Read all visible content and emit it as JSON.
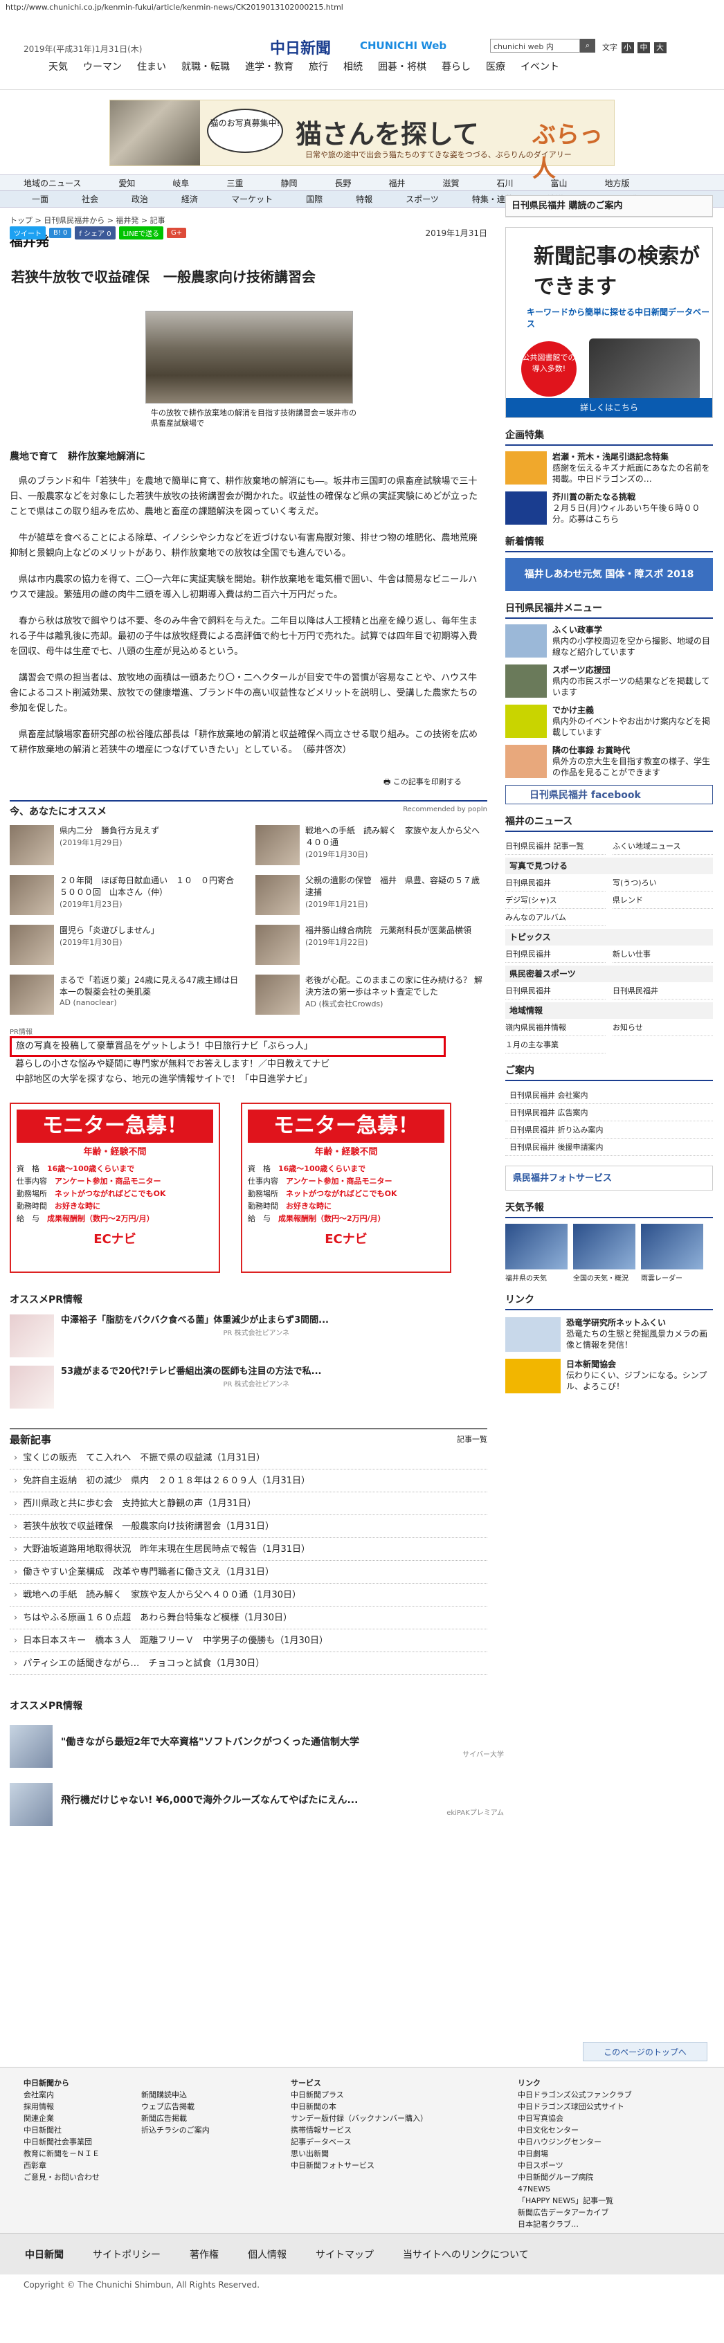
{
  "url": "http://www.chunichi.co.jp/kenmin-fukui/article/kenmin-news/CK2019013102000215.html",
  "header": {
    "date": "2019年(平成31年)1月31日(木)",
    "logo": "中日新聞",
    "logo_sub": "CHUNICHI Web",
    "search_placeholder": "chunichi web 内",
    "search_btn": "検索",
    "font_label": "文字",
    "font_small": "小",
    "font_mid": "中",
    "font_large": "大"
  },
  "gnav": [
    "天気",
    "ウーマン",
    "住まい",
    "就職・転職",
    "進学・教育",
    "旅行",
    "相続",
    "囲碁・将棋",
    "暮らし",
    "医療",
    "イベント"
  ],
  "banner": {
    "bubble": "猫のお写真募集中!",
    "title": "猫さんを探して",
    "sub": "日常や旅の途中で出会う猫たちのすてきな姿をつづる、ぶらりんのダイアリー",
    "brand": "ぶらっ人"
  },
  "cnav1": [
    "地域のニュース",
    "愛知",
    "岐阜",
    "三重",
    "静岡",
    "長野",
    "福井",
    "滋賀",
    "石川",
    "富山",
    "地方版"
  ],
  "cnav2": [
    "一面",
    "社会",
    "政治",
    "経済",
    "マーケット",
    "国際",
    "特報",
    "スポーツ",
    "特集・連載",
    "社説・コラム",
    "動画"
  ],
  "breadcrumb": "トップ > 日刊県民福井から > 福井発 > 記事",
  "section": "福井発",
  "share": [
    "ツイート",
    "B! 0",
    "f シェア 0",
    "LINEで送る",
    "G+"
  ],
  "article": {
    "date": "2019年1月31日",
    "headline": "若狭牛放牧で収益確保　一般農家向け技術講習会",
    "caption": "牛の放牧で耕作放棄地の解消を目指す技術講習会＝坂井市の県畜産試験場で",
    "subhead": "農地で育て　耕作放棄地解消に",
    "paragraphs": [
      "県のブランド和牛「若狭牛」を農地で簡単に育て、耕作放棄地の解消にも―。坂井市三国町の県畜産試験場で三十日、一般農家などを対象にした若狭牛放牧の技術講習会が開かれた。収益性の確保など県の実証実験にめどが立ったことで県はこの取り組みを広め、農地と畜産の課題解決を図っていく考えだ。",
      "牛が雑草を食べることによる除草、イノシシやシカなどを近づけない有害鳥獣対策、排せつ物の堆肥化、農地荒廃抑制と景観向上などのメリットがあり、耕作放棄地での放牧は全国でも進んでいる。",
      "県は市内農家の協力を得て、二〇一六年に実証実験を開始。耕作放棄地を電気柵で囲い、牛舎は簡易なビニールハウスで建設。繁殖用の雌の肉牛二頭を導入し初期導入費は約二百六十万円だった。",
      "春から秋は放牧で餌やりは不要、冬のみ牛舎で飼料を与えた。二年目以降は人工授精と出産を繰り返し、毎年生まれる子牛は離乳後に売却。最初の子牛は放牧経費による高評価で約七十万円で売れた。試算では四年目で初期導入費を回収、母牛は生産で七、八頭の生産が見込めるという。",
      "講習会で県の担当者は、放牧地の面積は一頭あたり〇・二ヘクタールが目安で牛の習慣が容易なことや、ハウス牛舎によるコスト削減効果、放牧での健康増進、ブランド牛の高い収益性などメリットを説明し、受講した農家たちの参加を促した。",
      "県畜産試験場家畜研究部の松谷隆広部長は「耕作放棄地の解消と収益確保へ両立させる取り組み。この技術を広めて耕作放棄地の解消と若狭牛の増産につなげていきたい」としている。　（藤井啓次）"
    ],
    "print": "この記事を印刷する"
  },
  "recommend": {
    "title": "今、あなたにオススメ",
    "by": "Recommended by popIn",
    "items": [
      {
        "t": "県内二分　勝負行方見えず",
        "s": "(2019年1月29日)"
      },
      {
        "t": "戦地への手紙　読み解く　家族や友人から父へ４００通",
        "s": "(2019年1月30日)"
      },
      {
        "t": "２０年間　ほぼ毎日献血通い　１０　０円寄合５０００回　山本さん（仲）",
        "s": "(2019年1月23日)"
      },
      {
        "t": "父親の遺影の保管　福井　県豊、容疑の５７歳逮捕",
        "s": "(2019年1月21日)"
      },
      {
        "t": "園児ら「炎遊びしません」",
        "s": "(2019年1月30日)"
      },
      {
        "t": "福井勝山線合病院　元薬剤科長が医薬品横領",
        "s": "(2019年1月22日)"
      },
      {
        "t": "まるで「若返り薬」24歳に見える47歳主婦は日本一の製薬会社の美肌薬",
        "s": "AD (nanoclear)"
      },
      {
        "t": "老後が心配。このままこの家に住み続ける？ 解決方法の第一歩はネット査定でした",
        "s": "AD (株式会社Crowds)"
      }
    ]
  },
  "pr": {
    "label": "PR情報",
    "items": [
      "旅の写真を投稿して豪華賞品をゲットしよう！中日旅行ナビ「ぶらっ人」",
      "暮らしの小さな悩みや疑問に専門家が無料でお答えします！／中日教えてナビ",
      "中部地区の大学を探すなら、地元の進学情報サイトで！「中日進学ナビ」"
    ]
  },
  "monitor": {
    "title": "モニター急募！",
    "age": "年齢・経験不問",
    "rows": [
      [
        "資　格",
        "16歳～100歳くらいまで"
      ],
      [
        "仕事内容",
        "アンケート参加・商品モニター"
      ],
      [
        "勤務場所",
        "ネットがつながればどこでもOK"
      ],
      [
        "勤務時間",
        "お好きな時に"
      ],
      [
        "給　与",
        "成果報酬制（数円～2万円/月）"
      ]
    ],
    "logo": "ECナビ"
  },
  "ospr": {
    "title": "オススメPR情報",
    "items": [
      {
        "t": "中澤裕子「脂肪をバクバク食べる菌」体重減少が止まらず3問間...",
        "s": "PR 株式会社ピアンネ"
      },
      {
        "t": "53歳がまるで20代?!テレビ番組出演の医師も注目の方法で私...",
        "s": "PR 株式会社ピアンネ"
      }
    ]
  },
  "latest": {
    "title": "最新記事",
    "more": "記事一覧",
    "items": [
      "宝くじの販売　てこ入れへ　不振で県の収益減（1月31日）",
      "免許自主返納　初の減少　県内　２０１８年は２６０９人（1月31日）",
      "西川県政と共に歩む会　支持拡大と静観の声（1月31日）",
      "若狭牛放牧で収益確保　一般農家向け技術講習会（1月31日）",
      "大野油坂道路用地取得状況　昨年末現在生居民時点で報告（1月31日）",
      "働きやすい企業構成　改革や専門職者に働き文え（1月31日）",
      "戦地への手紙　読み解く　家族や友人から父へ４００通（1月30日）",
      "ちはやふる原画１６０点超　あわら舞台特集など模様（1月30日）",
      "日本日本スキー　橋本３人　距離フリーＶ　中学男子の優勝も（1月30日）",
      "パティシエの話聞きながら…　チョコっと試食（1月30日）"
    ]
  },
  "ospr2": {
    "title": "オススメPR情報",
    "items": [
      {
        "t": "\"働きながら最短2年で大卒資格\"ソフトバンクがつくった通信制大学",
        "s": "サイバー大学"
      },
      {
        "t": "飛行機だけじゃない! ¥6,000で海外クルーズなんてやばたにえん...",
        "s": "ekiPAKプレミアム"
      }
    ]
  },
  "side": {
    "subscribe": "日刊県民福井 購読のご案内",
    "kad_title": "新聞記事の検索ができます",
    "kad_key": "キーワードから簡単に探せる中日新聞データベース",
    "kad_circle": "公共図書館での導入多数!",
    "kad_btn": "詳しくはこちら",
    "special": "企画特集",
    "sp": [
      {
        "t": "岩瀬・荒木・浅尾引退記念特集",
        "d": "感謝を伝えるキズナ紙面にあなたの名前を掲載。中日ドラゴンズの…"
      },
      {
        "t": "芥川賞の新たなる挑戦",
        "d": "２月５日(月)ウィルあいち午後６時００分。応募はこちら"
      }
    ],
    "shinjin": "新着情報",
    "shinjin_banner": "福井しあわせ元気 国体・障スポ 2018",
    "menu": "日刊県民福井メニュー",
    "menu_items": [
      {
        "t": "ふくい政事学",
        "d": "県内の小学校周辺を空から撮影、地域の目線など紹介しています"
      },
      {
        "t": "スポーツ応援団",
        "d": "県内の市民スポーツの結果などを掲載しています"
      },
      {
        "t": "でかけ主義",
        "d": "県内外のイベントやお出かけ案内などを掲載しています"
      },
      {
        "t": "隣の仕事録 お賞時代",
        "d": "県外方の京大生を目指す教室の様子、学生の作品を見ることができます"
      }
    ],
    "fb": "日刊県民福井 facebook",
    "fnews": "福井のニュース",
    "fnews_items": [
      "日刊県民福井 記事一覧",
      "ふくい地域ニュース"
    ],
    "photo_cat": "写真で見つける",
    "photo_items": [
      "日刊県民福井",
      "写(うつ)ろい",
      "デジ写(シャ)ス",
      "県レンド",
      "みんなのアルバム"
    ],
    "topics": "トピックス",
    "topics_items": [
      "日刊県民福井",
      "新しい仕事"
    ],
    "sports": "県民密着スポーツ",
    "sports_items": [
      "日刊県民福井",
      "日刊県民福井"
    ],
    "chiiki": "地域情報",
    "chiiki_items": [
      "嶺内県民福井情報",
      "お知らせ",
      "１月の主な事業"
    ],
    "guide": "ご案内",
    "guide_items": [
      "日刊県民福井 会社案内",
      "日刊県民福井 広告案内",
      "日刊県民福井 折り込み案内",
      "日刊県民福井 後援申請案内"
    ],
    "photoservice": "県民福井フォトサービス",
    "tenki": "天気予報",
    "tenki_items": [
      "福井県の天気",
      "全国の天気・概況",
      "雨雲レーダー"
    ],
    "link": "リンク",
    "links": [
      {
        "t": "恐竜学研究所ネットふくい",
        "d": "恐竜たちの生態と発掘風景カメラの画像と情報を発信！"
      },
      {
        "t": "日本新聞協会",
        "d": "伝わりにくい、ジブンになる。シンプル、よろこび！"
      }
    ]
  },
  "pagetop": "このページのトップへ",
  "footer": {
    "c1": {
      "h": "中日新聞から",
      "items": [
        "会社案内",
        "採用情報",
        "関連企業",
        "中日新聞社",
        "中日新聞社会事業団",
        "教育に新聞を－ＮＩＥ",
        "西彰章",
        "ご意見・お問い合わせ"
      ]
    },
    "c2": {
      "h": "",
      "items": [
        "新聞購読申込",
        "ウェブ広告掲載",
        "新聞広告掲載",
        "折込チラシのご案内"
      ]
    },
    "c3": {
      "h": "サービス",
      "items": [
        "中日新聞プラス",
        "中日新聞の本",
        "サンデー版付録（バックナンバー購入）",
        "携帯情報サービス",
        "記事データベース",
        "思い出新聞",
        "中日新聞フォトサービス"
      ]
    },
    "c4": {
      "h": "リンク",
      "items": [
        "中日ドラゴンズ公式ファンクラブ",
        "中日ドラゴンズ球団公式サイト",
        "中日写真協会",
        "中日文化センター",
        "中日ハウジングセンター",
        "中日劇場",
        "中日スポーツ",
        "中日新聞グループ病院",
        "47NEWS",
        "「HAPPY NEWS」記事一覧",
        "新聞広告データアーカイブ",
        "日本記者クラブ…"
      ]
    }
  },
  "bottomnav": [
    "中日新聞",
    "サイトポリシー",
    "著作権",
    "個人情報",
    "サイトマップ",
    "当サイトへのリンクについて"
  ],
  "copyright": "Copyright © The Chunichi Shimbun, All Rights Reserved."
}
